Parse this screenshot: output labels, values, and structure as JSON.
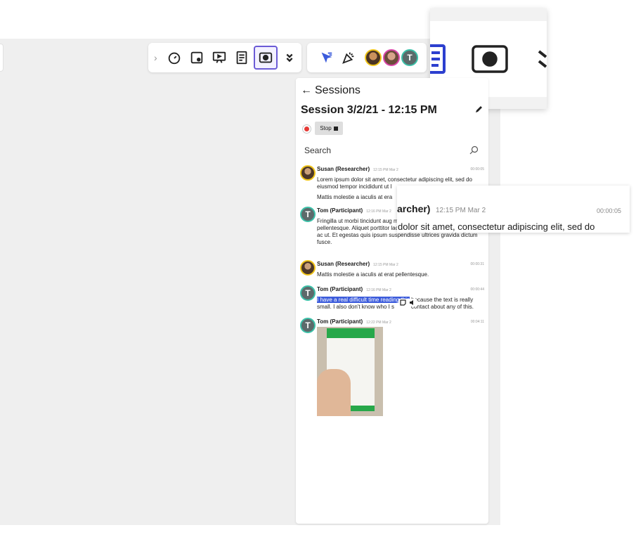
{
  "sessions_back_label": "Sessions",
  "session_title": "Session 3/2/21 - 12:15 PM",
  "stop_label": "Stop",
  "search_placeholder": "Search",
  "messages": [
    {
      "author": "Susan (Researcher)",
      "time": "12:15 PM Mar 2",
      "duration": "00:00:05",
      "paragraphs": [
        "Lorem ipsum dolor sit amet, consectetur adipiscing elit, sed do eiusmod tempor incididunt ut l",
        "Mattis molestie a iaculis at era"
      ],
      "avatar": "susan"
    },
    {
      "author": "Tom (Participant)",
      "time": "12:16 PM Mar 2",
      "duration": "",
      "paragraphs": [
        "Fringilla ut morbi tincidunt aug metus aliquam eleifend. Mattit pellentesque. Aliquet porttitor lacus luctus accumsan tortor posuere ac ut. Et egestas quis ipsum suspendisse ultrices gravida dictum fusce."
      ],
      "avatar": "T"
    },
    {
      "author": "Susan (Researcher)",
      "time": "12:15 PM Mar 2",
      "duration": "00:00:31",
      "paragraphs": [
        "Mattis molestie a iaculis at erat pellentesque."
      ],
      "avatar": "susan"
    },
    {
      "author": "Tom (Participant)",
      "time": "12:16 PM Mar 2",
      "duration": "00:00:44",
      "highlighted": "I have a real difficult time reading this",
      "rest": " because the text is really small. I also don't know who I s",
      "rest2": "contact about any of this.",
      "avatar": "T"
    },
    {
      "author": "Tom (Participant)",
      "time": "12:22 PM Mar 2",
      "duration": "00:04:11",
      "avatar": "T",
      "has_image": true
    }
  ],
  "zoom_overlay": {
    "name_fragment": "archer)",
    "time": "12:15 PM Mar 2",
    "duration": "00:00:05",
    "body_fragment": "dolor sit amet, consectetur adipiscing elit, sed do"
  },
  "toolbar_avatar_tom": "T",
  "colors": {
    "accent": "#6b5bd6",
    "highlight": "#3b5bdb",
    "record": "#e53935"
  }
}
